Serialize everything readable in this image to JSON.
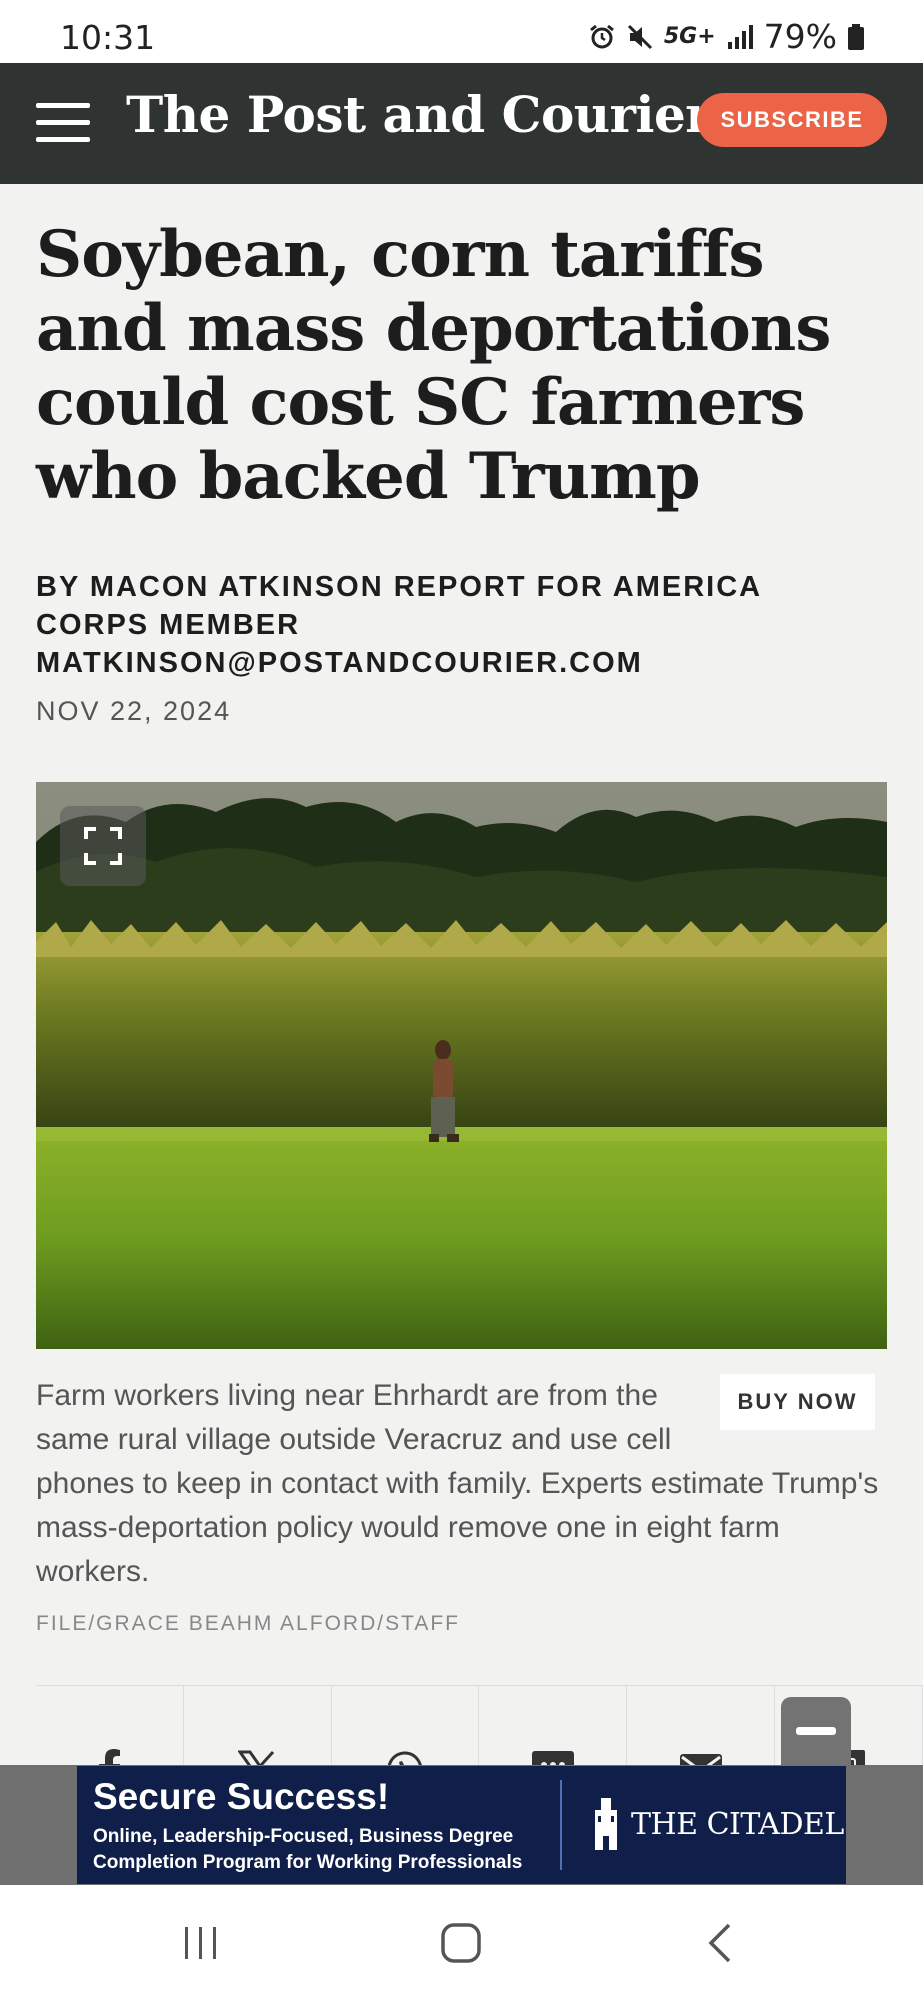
{
  "status_bar": {
    "time": "10:31",
    "network": "5G+",
    "battery": "79%",
    "icons": [
      "alarm-icon",
      "mute-icon",
      "signal-icon",
      "battery-icon"
    ]
  },
  "header": {
    "logo": "The Post and Courier",
    "subscribe_label": "SUBSCRIBE",
    "accent_color": "#ec6447",
    "background_color": "#2f3331"
  },
  "article": {
    "headline": "Soybean, corn tariffs and mass deportations could cost SC farmers who backed Trump",
    "byline": "BY MACON ATKINSON REPORT FOR AMERICA CORPS MEMBER MATKINSON@POSTANDCOURIER.COM",
    "date": "NOV 22, 2024",
    "caption": "Farm workers living near Ehrhardt are from the same rural village outside Veracruz and use cell phones to keep in contact with family. Experts estimate Trump's mass-deportation policy would remove one in eight farm workers.",
    "buy_now_label": "BUY NOW",
    "photo_credit": "FILE/GRACE BEAHM ALFORD/STAFF"
  },
  "share": {
    "items": [
      "facebook-icon",
      "x-icon",
      "whatsapp-icon",
      "sms-icon",
      "email-icon",
      "copy-icon"
    ]
  },
  "ad": {
    "title": "Secure Success!",
    "line1": "Online, Leadership-Focused, Business Degree",
    "line2": "Completion Program for Working Professionals",
    "brand": "THE CITADEL"
  }
}
